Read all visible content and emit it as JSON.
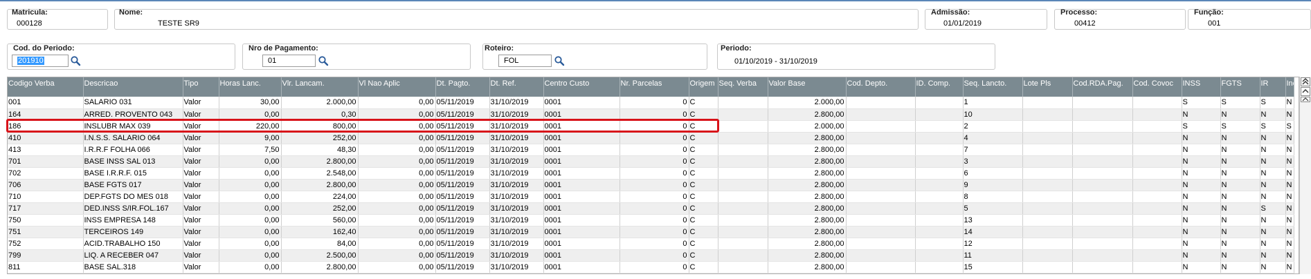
{
  "header": {
    "matricula": {
      "label": "Matricula:",
      "value": "000128"
    },
    "nome": {
      "label": "Nome:",
      "value": "TESTE SR9"
    },
    "admissao": {
      "label": "Admissão:",
      "value": "01/01/2019"
    },
    "processo": {
      "label": "Processo:",
      "value": "00412"
    },
    "funcao": {
      "label": "Função:",
      "value": "001"
    }
  },
  "filters": {
    "cod_periodo": {
      "label": "Cod. do Periodo:",
      "value": "201910"
    },
    "nro_pagamento": {
      "label": "Nro de Pagamento:",
      "value": "01"
    },
    "roteiro": {
      "label": "Roteiro:",
      "value": "FOL"
    },
    "periodo": {
      "label": "Periodo:",
      "value": "01/10/2019 - 31/10/2019"
    }
  },
  "grid": {
    "columns": [
      "Codigo Verba",
      "Descricao",
      "Tipo",
      "Horas Lanc.",
      "Vlr. Lancam.",
      "Vl Nao Aplic",
      "Dt. Pagto.",
      "Dt. Ref.",
      "Centro Custo",
      "Nr. Parcelas",
      "Origem",
      "Seq. Verba",
      "Valor Base",
      "Cod. Depto.",
      "ID. Comp.",
      "Seq. Lancto.",
      "Lote Pls",
      "Cod.RDA.Pag.",
      "Cod. Covoc",
      "INSS",
      "FGTS",
      "IR",
      "Inc"
    ],
    "rows": [
      [
        "001",
        "SALARIO 031",
        "Valor",
        "30,00",
        "2.000,00",
        "0,00",
        "05/11/2019",
        "31/10/2019",
        "0001",
        "0",
        "C",
        "",
        "2.000,00",
        "",
        "",
        "1",
        "",
        "",
        "",
        "S",
        "S",
        "S",
        "N"
      ],
      [
        "164",
        "ARRED. PROVENTO 043",
        "Valor",
        "0,00",
        "0,30",
        "0,00",
        "05/11/2019",
        "31/10/2019",
        "0001",
        "0",
        "C",
        "",
        "2.800,00",
        "",
        "",
        "10",
        "",
        "",
        "",
        "N",
        "N",
        "N",
        "N"
      ],
      [
        "186",
        "INSLUBR MAX 039",
        "Valor",
        "220,00",
        "800,00",
        "0,00",
        "05/11/2019",
        "31/10/2019",
        "0001",
        "0",
        "C",
        "",
        "2.000,00",
        "",
        "",
        "2",
        "",
        "",
        "",
        "S",
        "S",
        "S",
        "S"
      ],
      [
        "410",
        "I.N.S.S. SALARIO 064",
        "Valor",
        "9,00",
        "252,00",
        "0,00",
        "05/11/2019",
        "31/10/2019",
        "0001",
        "0",
        "C",
        "",
        "2.800,00",
        "",
        "",
        "4",
        "",
        "",
        "",
        "N",
        "N",
        "N",
        "N"
      ],
      [
        "413",
        "I.R.R.F FOLHA 066",
        "Valor",
        "7,50",
        "48,30",
        "0,00",
        "05/11/2019",
        "31/10/2019",
        "0001",
        "0",
        "C",
        "",
        "2.800,00",
        "",
        "",
        "7",
        "",
        "",
        "",
        "N",
        "N",
        "N",
        "N"
      ],
      [
        "701",
        "BASE INSS SAL 013",
        "Valor",
        "0,00",
        "2.800,00",
        "0,00",
        "05/11/2019",
        "31/10/2019",
        "0001",
        "0",
        "C",
        "",
        "2.800,00",
        "",
        "",
        "3",
        "",
        "",
        "",
        "N",
        "N",
        "N",
        "N"
      ],
      [
        "702",
        "BASE I.R.R.F. 015",
        "Valor",
        "0,00",
        "2.548,00",
        "0,00",
        "05/11/2019",
        "31/10/2019",
        "0001",
        "0",
        "C",
        "",
        "2.800,00",
        "",
        "",
        "6",
        "",
        "",
        "",
        "N",
        "N",
        "N",
        "N"
      ],
      [
        "706",
        "BASE FGTS 017",
        "Valor",
        "0,00",
        "2.800,00",
        "0,00",
        "05/11/2019",
        "31/10/2019",
        "0001",
        "0",
        "C",
        "",
        "2.800,00",
        "",
        "",
        "9",
        "",
        "",
        "",
        "N",
        "N",
        "N",
        "N"
      ],
      [
        "710",
        "DEP.FGTS DO MES 018",
        "Valor",
        "0,00",
        "224,00",
        "0,00",
        "05/11/2019",
        "31/10/2019",
        "0001",
        "0",
        "C",
        "",
        "2.800,00",
        "",
        "",
        "8",
        "",
        "",
        "",
        "N",
        "N",
        "N",
        "N"
      ],
      [
        "717",
        "DED.INSS S/IR.FOL.167",
        "Valor",
        "0,00",
        "252,00",
        "0,00",
        "05/11/2019",
        "31/10/2019",
        "0001",
        "0",
        "C",
        "",
        "2.800,00",
        "",
        "",
        "5",
        "",
        "",
        "",
        "N",
        "N",
        "S",
        "N"
      ],
      [
        "750",
        "INSS EMPRESA 148",
        "Valor",
        "0,00",
        "560,00",
        "0,00",
        "05/11/2019",
        "31/10/2019",
        "0001",
        "0",
        "C",
        "",
        "2.800,00",
        "",
        "",
        "13",
        "",
        "",
        "",
        "N",
        "N",
        "N",
        "N"
      ],
      [
        "751",
        "TERCEIROS 149",
        "Valor",
        "0,00",
        "162,40",
        "0,00",
        "05/11/2019",
        "31/10/2019",
        "0001",
        "0",
        "C",
        "",
        "2.800,00",
        "",
        "",
        "14",
        "",
        "",
        "",
        "N",
        "N",
        "N",
        "N"
      ],
      [
        "752",
        "ACID.TRABALHO 150",
        "Valor",
        "0,00",
        "84,00",
        "0,00",
        "05/11/2019",
        "31/10/2019",
        "0001",
        "0",
        "C",
        "",
        "2.800,00",
        "",
        "",
        "12",
        "",
        "",
        "",
        "N",
        "N",
        "N",
        "N"
      ],
      [
        "799",
        "LIQ. A RECEBER 047",
        "Valor",
        "0,00",
        "2.500,00",
        "0,00",
        "05/11/2019",
        "31/10/2019",
        "0001",
        "0",
        "C",
        "",
        "2.800,00",
        "",
        "",
        "11",
        "",
        "",
        "",
        "N",
        "N",
        "N",
        "N"
      ],
      [
        "811",
        "BASE SAL.318",
        "Valor",
        "0,00",
        "2.800,00",
        "0,00",
        "05/11/2019",
        "31/10/2019",
        "0001",
        "0",
        "C",
        "",
        "2.800,00",
        "",
        "",
        "15",
        "",
        "",
        "",
        "N",
        "N",
        "N",
        "N"
      ]
    ]
  },
  "colors": {
    "header_bg": "#7b8a91",
    "highlight_border": "#d8131a",
    "selection": "#3399ff",
    "top_line": "#5a86b8"
  },
  "icons": {
    "lookup": "magnifier-icon",
    "scroll_top": "double-chevron-up-icon",
    "scroll_up": "chevron-up-icon"
  }
}
